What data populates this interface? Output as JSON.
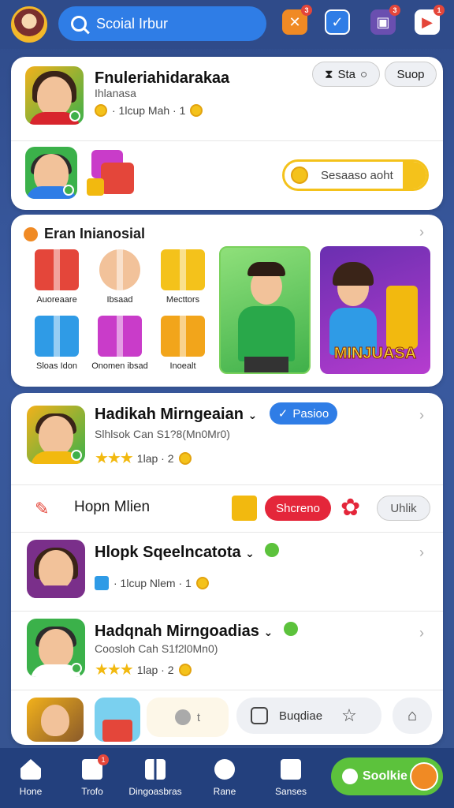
{
  "header": {
    "search_placeholder": "Scoial Irbur",
    "icons": [
      "profile-avatar",
      "search-icon",
      "lightning-icon",
      "check-icon",
      "briefcase-icon",
      "video-icon"
    ],
    "badges": [
      "3",
      "3",
      "1"
    ]
  },
  "profile_card": {
    "name": "Fnuleriahidarakaa",
    "subtitle": "Ihlanasa",
    "meta": "· 1lcup Mah · 1",
    "action1": "Sta",
    "action2": "Suop",
    "progress_label": "Sesaaso aoht"
  },
  "featured": {
    "title": "Eran Inianosial",
    "items": [
      {
        "label": "Auoreaare"
      },
      {
        "label": "Ibsaad"
      },
      {
        "label": "Mecttors"
      },
      {
        "label": "Sloas Idon"
      },
      {
        "label": "Onomen ibsad"
      },
      {
        "label": "Inoealt"
      }
    ],
    "banner_text": "MINJUASA"
  },
  "list": {
    "row1": {
      "name": "Hadikah Mirngeaian",
      "sub": "Slhlsok Can S1?8(Mn0Mr0)",
      "meta": "1lap · 2",
      "tag": "Pasioo"
    },
    "row2": {
      "label": "Hopn Mlien",
      "button": "Shcreno",
      "button2": "Uhlik"
    },
    "row3": {
      "name": "Hlopk Sqeelncatota",
      "meta": "· 1lcup Nlem · 1"
    },
    "row4": {
      "name": "Hadqnah Mirngoadias",
      "sub": "Coosloh Cah S1f2l0Mn0)",
      "meta": "1lap · 2"
    },
    "row5": {
      "button": "Buqdiae",
      "icon_label": "t"
    }
  },
  "navbar": {
    "items": [
      "Hone",
      "Trofo",
      "Dingoasbras",
      "Rane",
      "Sanses"
    ],
    "cta": "Soolkie"
  }
}
